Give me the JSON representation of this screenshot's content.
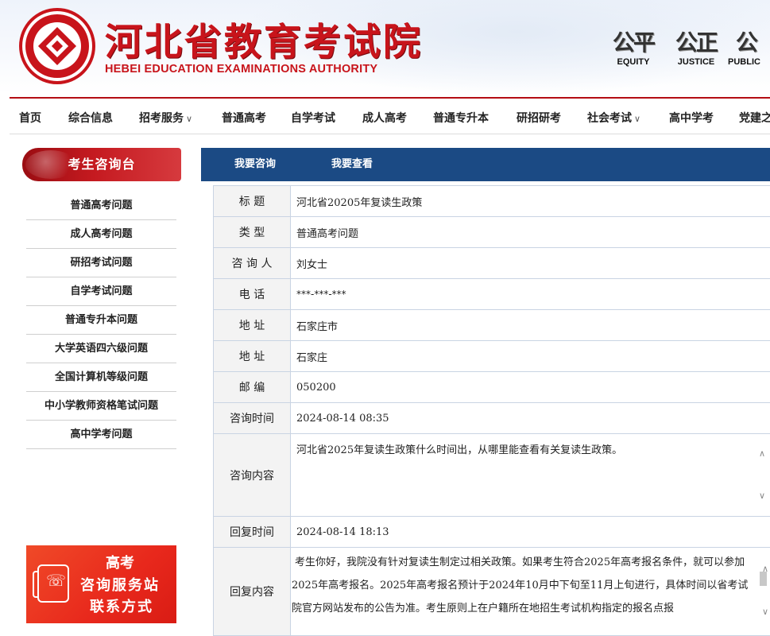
{
  "header": {
    "title_cn": "河北省教育考试院",
    "title_en": "HEBEI EDUCATION EXAMINATIONS AUTHORITY",
    "mottos": [
      {
        "zh": "公平",
        "en": "EQUITY"
      },
      {
        "zh": "公正",
        "en": "JUSTICE"
      },
      {
        "zh": "公",
        "en": "PUBLIC"
      }
    ]
  },
  "nav": {
    "items": [
      {
        "label": "首页",
        "dropdown": false
      },
      {
        "label": "综合信息",
        "dropdown": false
      },
      {
        "label": "招考服务",
        "dropdown": true
      },
      {
        "label": "普通高考",
        "dropdown": false
      },
      {
        "label": "自学考试",
        "dropdown": false
      },
      {
        "label": "成人高考",
        "dropdown": false
      },
      {
        "label": "普通专升本",
        "dropdown": false
      },
      {
        "label": "研招研考",
        "dropdown": false
      },
      {
        "label": "社会考试",
        "dropdown": true
      },
      {
        "label": "高中学考",
        "dropdown": false
      },
      {
        "label": "党建之",
        "dropdown": false
      }
    ],
    "chevron": "∨"
  },
  "sidebar": {
    "title": "考生咨询台",
    "items": [
      "普通高考问题",
      "成人高考问题",
      "研招考试问题",
      "自学考试问题",
      "普通专升本问题",
      "大学英语四六级问题",
      "全国计算机等级问题",
      "中小学教师资格笔试问题",
      "高中学考问题"
    ],
    "banner": {
      "line1": "高考",
      "line2": "咨询服务站",
      "line3": "联系方式"
    }
  },
  "tabs": [
    "我要咨询",
    "我要查看"
  ],
  "form": {
    "rows": [
      {
        "label": "标 题",
        "value": "河北省20205年复读生政策"
      },
      {
        "label": "类 型",
        "value": "普通高考问题"
      },
      {
        "label": "咨 询 人",
        "value": "刘女士"
      },
      {
        "label": "电 话",
        "value": "***-***-***"
      },
      {
        "label": "地 址",
        "value": "石家庄市"
      },
      {
        "label": "地 址",
        "value": "石家庄"
      },
      {
        "label": "邮 编",
        "value": "050200"
      },
      {
        "label": "咨询时间",
        "value": "2024-08-14 08:35"
      }
    ],
    "question_label": "咨询内容",
    "question_text": "河北省2025年复读生政策什么时间出，从哪里能查看有关复读生政策。",
    "reply_time_label": "回复时间",
    "reply_time": "2024-08-14 18:13",
    "reply_label": "回复内容",
    "reply_text": "考生你好，我院没有针对复读生制定过相关政策。如果考生符合2025年高考报名条件，就可以参加2025年高考报名。2025年高考报名预计于2024年10月中下旬至11月上旬进行，具体时间以省考试院官方网站发布的公告为准。考生原则上在户籍所在地招生考试机构指定的报名点报",
    "scroll_up": "∧",
    "scroll_down": "∨"
  },
  "colors": {
    "brand_red": "#c8141b",
    "nav_blue": "#1b4a84",
    "banner_red": "#e8281c"
  }
}
